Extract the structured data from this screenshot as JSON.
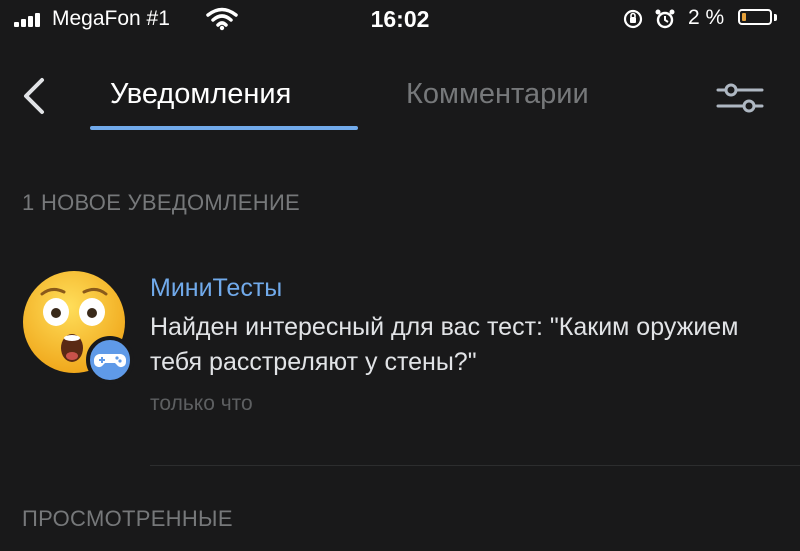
{
  "status_bar": {
    "carrier": "MegaFon #1",
    "time": "16:02",
    "battery": "2 %"
  },
  "header": {
    "tabs": [
      {
        "label": "Уведомления",
        "active": true
      },
      {
        "label": "Комментарии",
        "active": false
      }
    ],
    "accent_color": "#71aaeb"
  },
  "sections": {
    "new_title": "1 НОВОЕ УВЕДОМЛЕНИЕ",
    "seen_title": "ПРОСМОТРЕННЫЕ"
  },
  "notification": {
    "sender": "МиниТесты",
    "message": "Найден интересный для вас тест: \"Каким оружием тебя расстреляют у стены?\"",
    "time": "только что",
    "avatar_icon": "shocked-emoji-icon",
    "badge_icon": "gamepad-icon"
  }
}
